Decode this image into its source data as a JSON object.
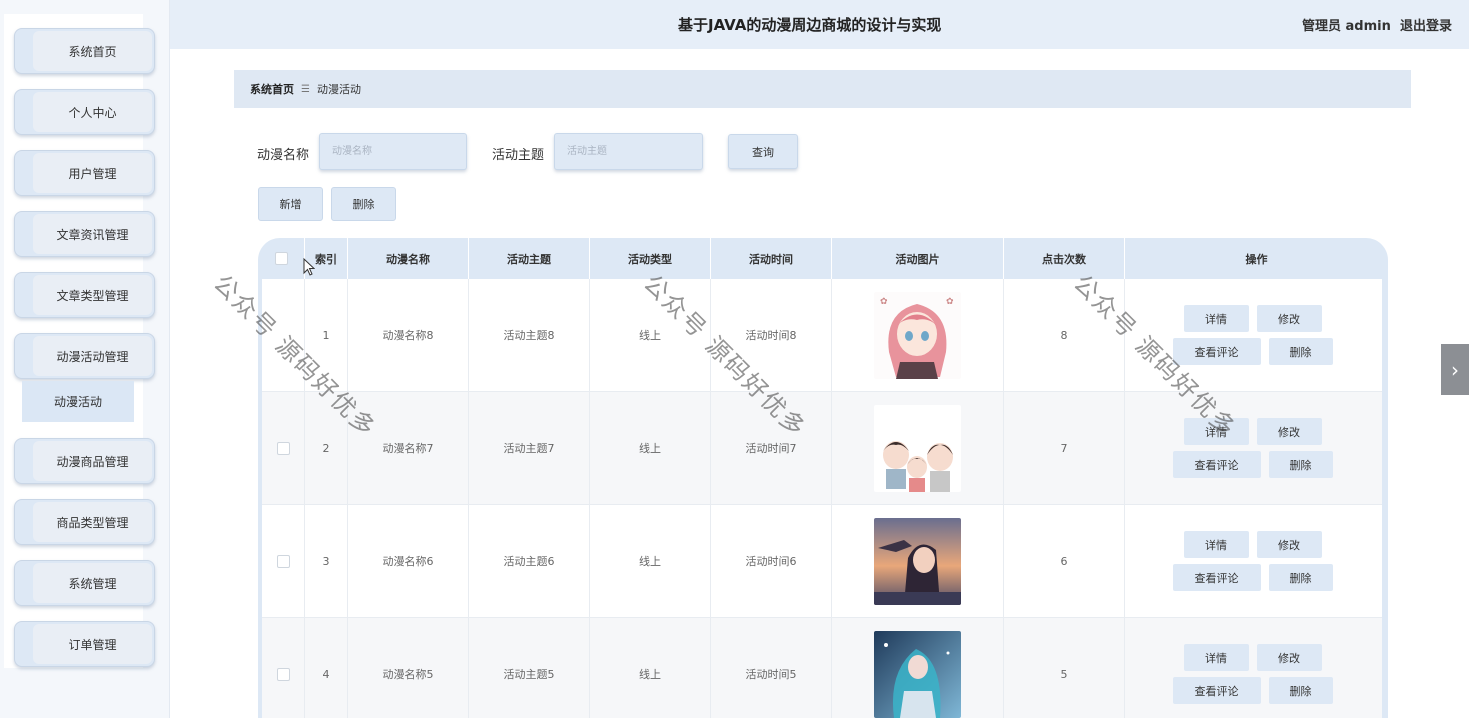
{
  "header": {
    "title": "基于JAVA的动漫周边商城的设计与实现",
    "user": "管理员 admin",
    "logout": "退出登录"
  },
  "sidebar": {
    "items": [
      {
        "label": "系统首页"
      },
      {
        "label": "个人中心"
      },
      {
        "label": "用户管理"
      },
      {
        "label": "文章资讯管理"
      },
      {
        "label": "文章类型管理"
      },
      {
        "label": "动漫活动管理"
      },
      {
        "label": "动漫商品管理"
      },
      {
        "label": "商品类型管理"
      },
      {
        "label": "系统管理"
      },
      {
        "label": "订单管理"
      }
    ],
    "submenu_active": "动漫活动"
  },
  "breadcrumb": {
    "home": "系统首页",
    "separator": "☰",
    "current": "动漫活动"
  },
  "search": {
    "name_label": "动漫名称",
    "name_placeholder": "动漫名称",
    "theme_label": "活动主题",
    "theme_placeholder": "活动主题",
    "query_button": "查询"
  },
  "actions": {
    "add": "新增",
    "delete": "删除"
  },
  "table": {
    "columns": [
      "索引",
      "动漫名称",
      "活动主题",
      "活动类型",
      "活动时间",
      "活动图片",
      "点击次数",
      "操作"
    ],
    "rows": [
      {
        "index": "1",
        "name": "动漫名称8",
        "theme": "活动主题8",
        "type": "线上",
        "time": "活动时间8",
        "image": "pink-hair-girl",
        "clicks": "8"
      },
      {
        "index": "2",
        "name": "动漫名称7",
        "theme": "活动主题7",
        "type": "线上",
        "time": "活动时间7",
        "image": "family-cartoon",
        "clicks": "7"
      },
      {
        "index": "3",
        "name": "动漫名称6",
        "theme": "活动主题6",
        "type": "线上",
        "time": "活动时间6",
        "image": "sunset-girl",
        "clicks": "6"
      },
      {
        "index": "4",
        "name": "动漫名称5",
        "theme": "活动主题5",
        "type": "线上",
        "time": "活动时间5",
        "image": "blue-hair-girl",
        "clicks": "5"
      }
    ],
    "row_actions": {
      "detail": "详情",
      "edit": "修改",
      "view_comments": "查看评论",
      "delete": "删除"
    }
  },
  "watermark": "公众号 源码好优多",
  "colors": {
    "accent_bg": "#dde8f5",
    "header_bg": "#e6eef8"
  }
}
